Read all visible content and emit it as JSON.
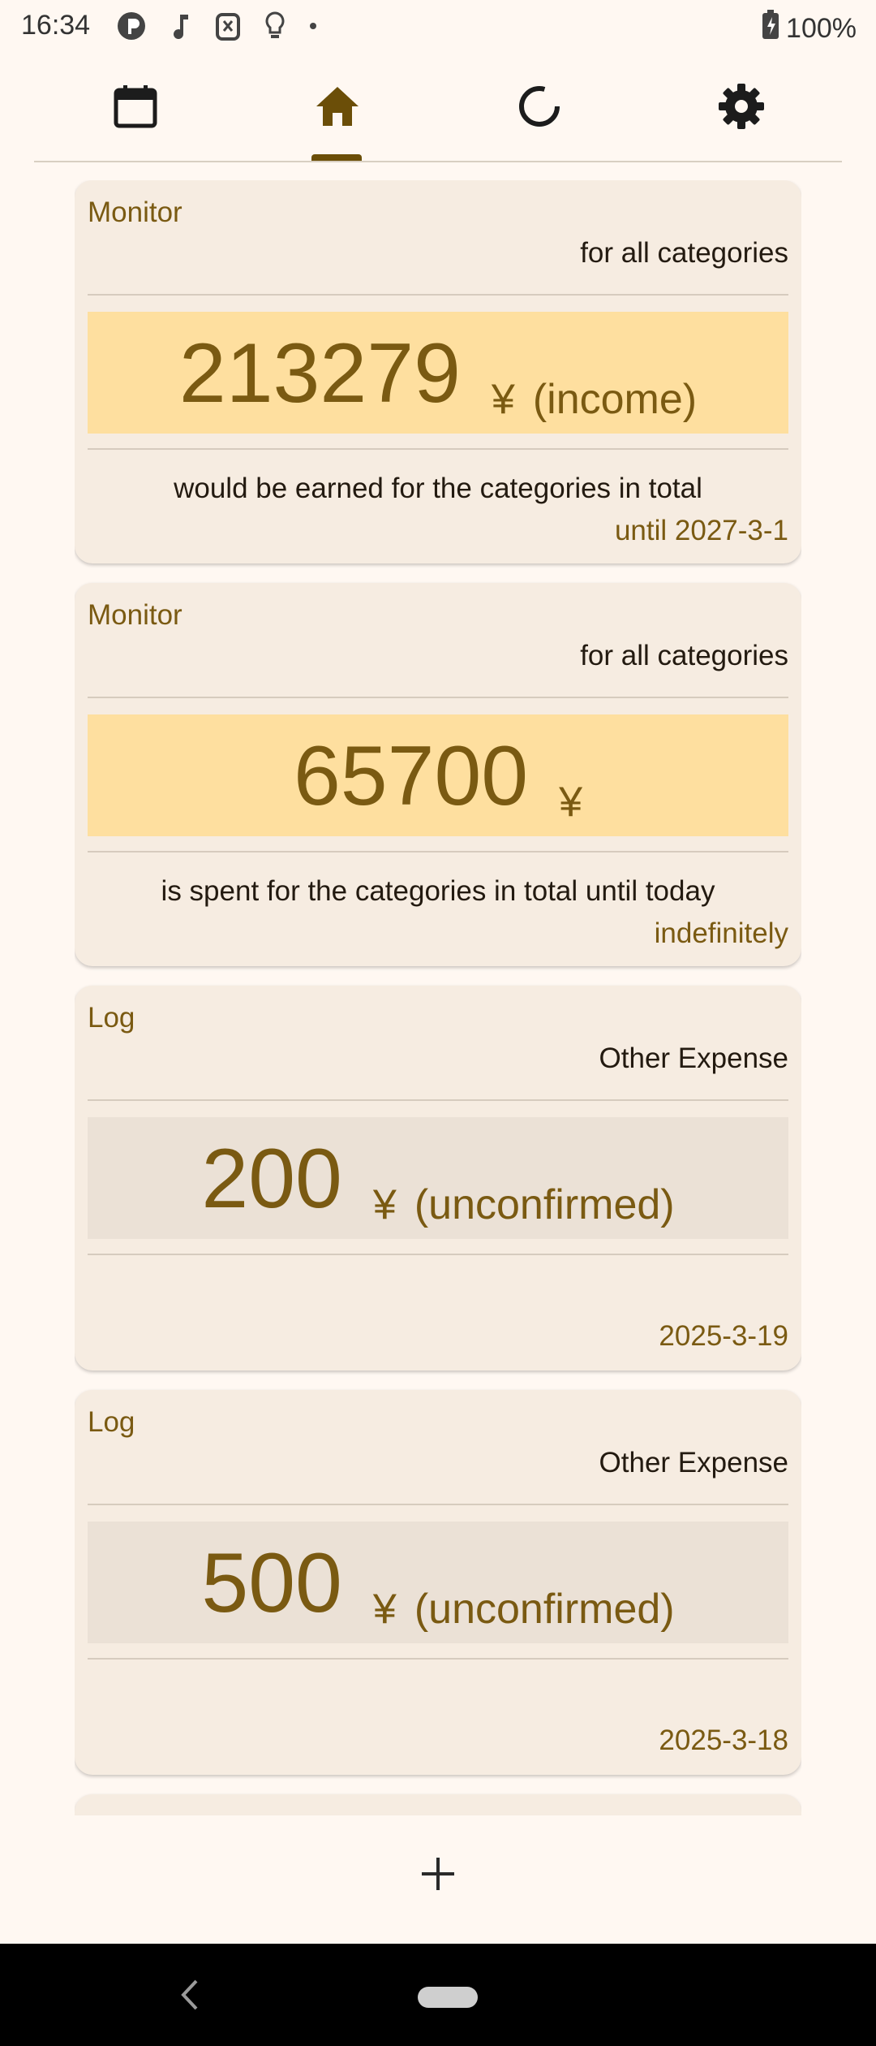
{
  "status_bar": {
    "time": "16:34",
    "battery": "100%"
  },
  "nav": {
    "tabs": [
      {
        "icon": "calendar-icon"
      },
      {
        "icon": "home-icon",
        "selected": true
      },
      {
        "icon": "progress-circle-icon"
      },
      {
        "icon": "gear-icon"
      }
    ]
  },
  "cards": [
    {
      "type": "Monitor",
      "scope": "for all categories",
      "amount": "213279",
      "currency": "¥",
      "qualifier": "(income)",
      "description": "would be earned for the categories in total",
      "date": "until 2027-3-1"
    },
    {
      "type": "Monitor",
      "scope": "for all categories",
      "amount": "65700",
      "currency": "¥",
      "qualifier": "",
      "description": "is spent for the categories in total until today",
      "date": "indefinitely"
    },
    {
      "type": "Log",
      "scope": "Other Expense",
      "amount": "200",
      "currency": "¥",
      "qualifier": "(unconfirmed)",
      "description": "",
      "date": "2025-3-19"
    },
    {
      "type": "Log",
      "scope": "Other Expense",
      "amount": "500",
      "currency": "¥",
      "qualifier": "(unconfirmed)",
      "description": "",
      "date": "2025-3-18"
    }
  ],
  "colors": {
    "accent": "#7a5a12",
    "card_background": "#f6ece1",
    "amount_highlight": "#fedf9f",
    "amount_unconfirmed": "#ebe1d6",
    "page_background": "#fff8f2"
  },
  "fab": {
    "icon": "plus-icon"
  }
}
